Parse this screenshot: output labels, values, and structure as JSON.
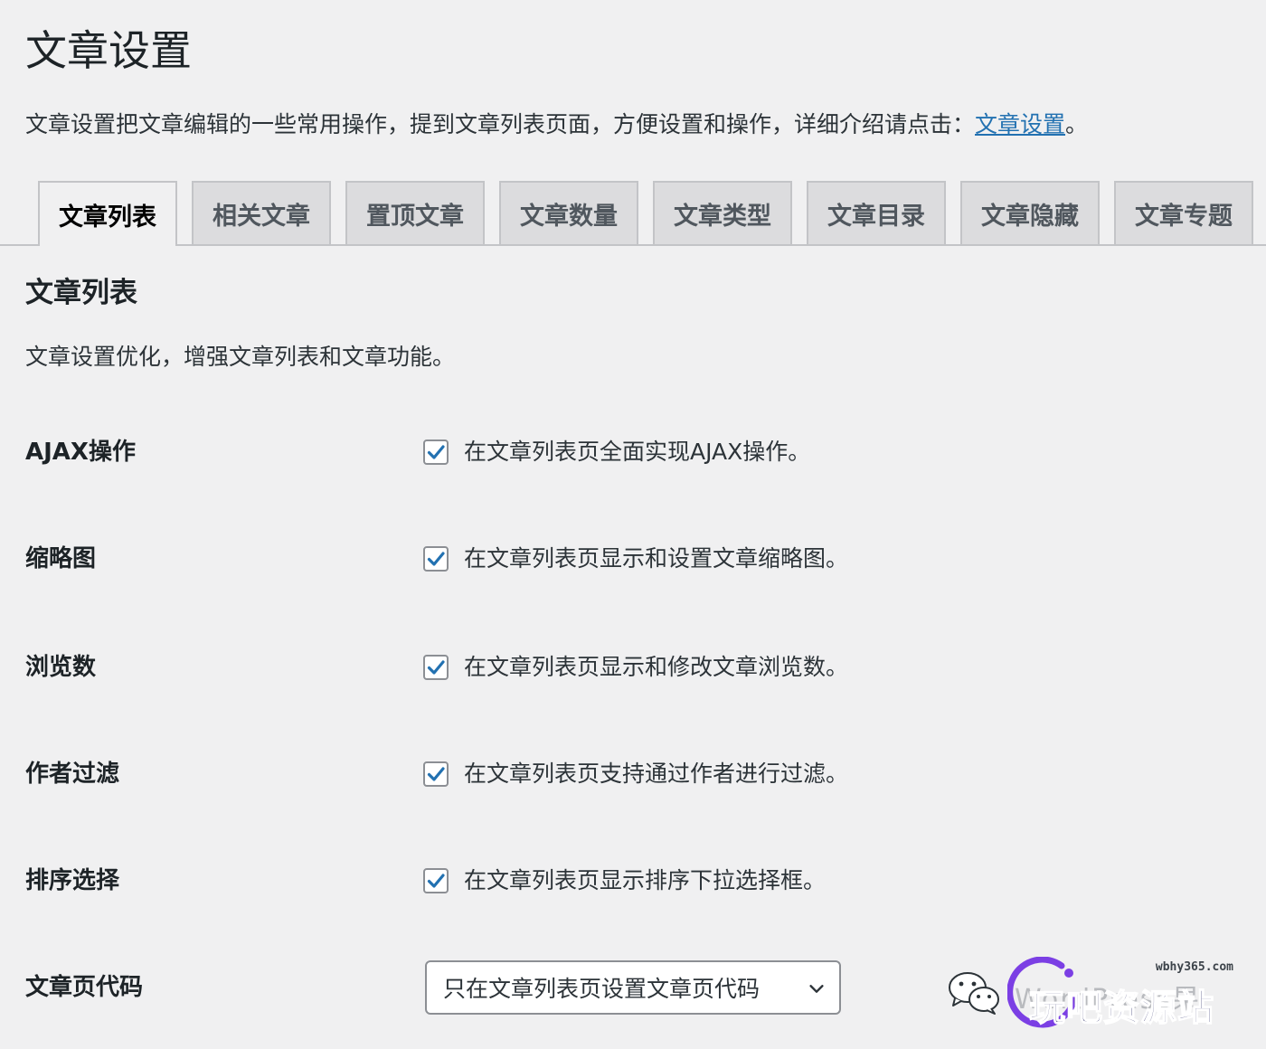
{
  "page": {
    "title": "文章设置",
    "intro_text": "文章设置把文章编辑的一些常用操作，提到文章列表页面，方便设置和操作，详细介绍请点击：",
    "intro_link": "文章设置",
    "intro_end": "。"
  },
  "tabs": [
    {
      "label": "文章列表",
      "active": true
    },
    {
      "label": "相关文章",
      "active": false
    },
    {
      "label": "置顶文章",
      "active": false
    },
    {
      "label": "文章数量",
      "active": false
    },
    {
      "label": "文章类型",
      "active": false
    },
    {
      "label": "文章目录",
      "active": false
    },
    {
      "label": "文章隐藏",
      "active": false
    },
    {
      "label": "文章专题",
      "active": false
    }
  ],
  "section": {
    "title": "文章列表",
    "description": "文章设置优化，增强文章列表和文章功能。"
  },
  "settings": [
    {
      "label": "AJAX操作",
      "checked": true,
      "description": "在文章列表页全面实现AJAX操作。"
    },
    {
      "label": "缩略图",
      "checked": true,
      "description": "在文章列表页显示和设置文章缩略图。"
    },
    {
      "label": "浏览数",
      "checked": true,
      "description": "在文章列表页显示和修改文章浏览数。"
    },
    {
      "label": "作者过滤",
      "checked": true,
      "description": "在文章列表页支持通过作者进行过滤。"
    },
    {
      "label": "排序选择",
      "checked": true,
      "description": "在文章列表页显示排序下拉选择框。"
    }
  ],
  "code_setting": {
    "label": "文章页代码",
    "selected": "只在文章列表页设置文章页代码"
  },
  "watermark": {
    "url": "wbhy365.com",
    "faint_text": "WordPress果",
    "name": "玩吧资源站"
  },
  "colors": {
    "background": "#f0f0f1",
    "link": "#2271b1",
    "checkmark": "#2271b1",
    "tab_inactive": "#dcdcde",
    "watermark_ring": "#7b3fe4"
  },
  "icons": {
    "checkbox": "checkmark-icon",
    "select": "chevron-down-icon",
    "watermark": "wechat-icon"
  }
}
